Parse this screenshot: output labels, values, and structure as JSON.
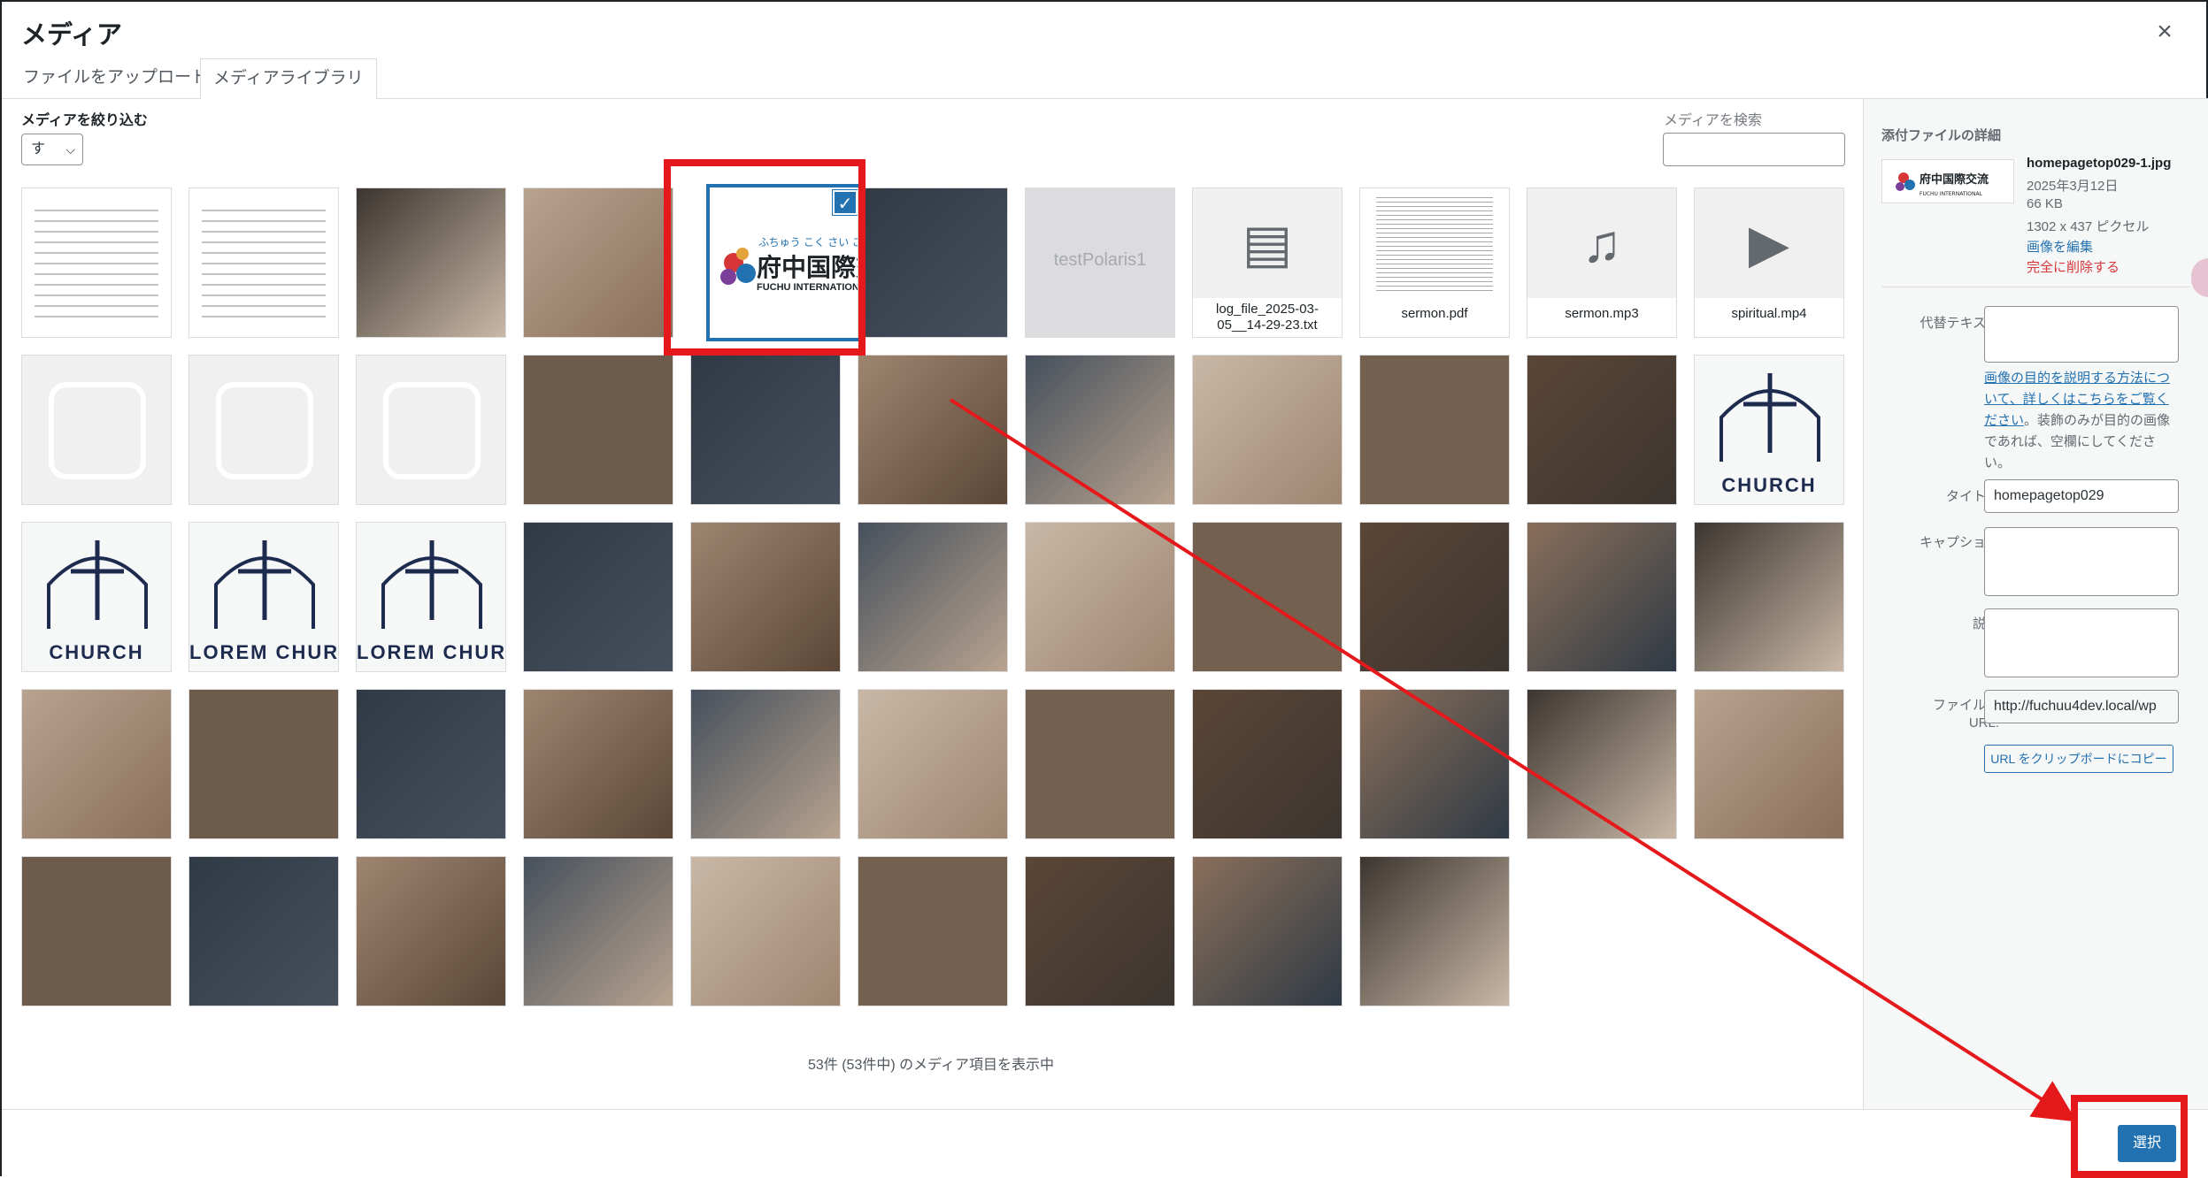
{
  "modal": {
    "title": "メディア",
    "close_glyph": "×",
    "tabs": {
      "upload": "ファイルをアップロード",
      "library": "メディアライブラリ"
    }
  },
  "toolbar": {
    "filter_label": "メディアを絞り込む",
    "filter_value": "す",
    "search_label": "メディアを検索",
    "search_value": ""
  },
  "media": [
    {
      "row": 0,
      "col": 0,
      "kind": "image",
      "desc": "japanese-worksheet"
    },
    {
      "row": 0,
      "col": 1,
      "kind": "image",
      "desc": "document-table"
    },
    {
      "row": 0,
      "col": 2,
      "kind": "image",
      "desc": "classroom-study"
    },
    {
      "row": 0,
      "col": 3,
      "kind": "image",
      "desc": "group-photo"
    },
    {
      "row": 0,
      "col": 4,
      "kind": "image",
      "desc": "fuchu-logo",
      "selected": true,
      "logo_text": "府中国際交",
      "logo_sub": "FUCHU INTERNATIONA",
      "logo_kana": "ふちゅう こく さい こう"
    },
    {
      "row": 0,
      "col": 5,
      "kind": "image",
      "desc": "group-photo-2"
    },
    {
      "row": 0,
      "col": 6,
      "kind": "placeholder",
      "text": "testPolaris1"
    },
    {
      "row": 0,
      "col": 7,
      "kind": "file",
      "glyph": "▤",
      "caption": "log_file_2025-03-05__14-29-23.txt"
    },
    {
      "row": 0,
      "col": 8,
      "kind": "pdf",
      "caption": "sermon.pdf"
    },
    {
      "row": 0,
      "col": 9,
      "kind": "file",
      "glyph": "♫",
      "caption": "sermon.mp3"
    },
    {
      "row": 0,
      "col": 10,
      "kind": "file",
      "glyph": "▶",
      "caption": "spiritual.mp4"
    },
    {
      "row": 1,
      "col": 0,
      "kind": "image",
      "desc": "heart-handshake-icon"
    },
    {
      "row": 1,
      "col": 1,
      "kind": "image",
      "desc": "church-outline"
    },
    {
      "row": 1,
      "col": 2,
      "kind": "image",
      "desc": "praying-hands-icon"
    },
    {
      "row": 1,
      "col": 3,
      "kind": "image",
      "desc": "priest-1"
    },
    {
      "row": 1,
      "col": 4,
      "kind": "image",
      "desc": "pastor-stole"
    },
    {
      "row": 1,
      "col": 5,
      "kind": "image",
      "desc": "priest-bible"
    },
    {
      "row": 1,
      "col": 6,
      "kind": "image",
      "desc": "priest-seated"
    },
    {
      "row": 1,
      "col": 7,
      "kind": "image",
      "desc": "man-arms-crossed"
    },
    {
      "row": 1,
      "col": 8,
      "kind": "image",
      "desc": "man-blazer"
    },
    {
      "row": 1,
      "col": 9,
      "kind": "image",
      "desc": "woman-smiling"
    },
    {
      "row": 1,
      "col": 10,
      "kind": "logo",
      "desc": "church-cross-doves",
      "text": "CHURCH"
    },
    {
      "row": 2,
      "col": 0,
      "kind": "logo",
      "desc": "church-hands-star",
      "text": "CHURCH"
    },
    {
      "row": 2,
      "col": 1,
      "kind": "logo",
      "desc": "lorem-church-arch",
      "text": "LOREM CHURCH"
    },
    {
      "row": 2,
      "col": 2,
      "kind": "logo",
      "desc": "lorem-church-building",
      "text": "LOREM CHURC"
    },
    {
      "row": 2,
      "col": 3,
      "kind": "image",
      "desc": "man-thinking"
    },
    {
      "row": 2,
      "col": 4,
      "kind": "image",
      "desc": "woman-reading"
    },
    {
      "row": 2,
      "col": 5,
      "kind": "image",
      "desc": "woman-lake"
    },
    {
      "row": 2,
      "col": 6,
      "kind": "image",
      "desc": "hands-jesus"
    },
    {
      "row": 2,
      "col": 7,
      "kind": "image",
      "desc": "family-prayer"
    },
    {
      "row": 2,
      "col": 8,
      "kind": "image",
      "desc": "couple-praying"
    },
    {
      "row": 2,
      "col": 9,
      "kind": "image",
      "desc": "pastor-purple"
    },
    {
      "row": 2,
      "col": 10,
      "kind": "image",
      "desc": "woman-pink"
    },
    {
      "row": 3,
      "col": 0,
      "kind": "image",
      "desc": "praying-rosary-dark"
    },
    {
      "row": 3,
      "col": 1,
      "kind": "image",
      "desc": "baptism"
    },
    {
      "row": 3,
      "col": 2,
      "kind": "image",
      "desc": "sunset-bible"
    },
    {
      "row": 3,
      "col": 3,
      "kind": "image",
      "desc": "woman-praying-blur"
    },
    {
      "row": 3,
      "col": 4,
      "kind": "image",
      "desc": "raised-hands-bw"
    },
    {
      "row": 3,
      "col": 5,
      "kind": "image",
      "desc": "teacher-whiteboard"
    },
    {
      "row": 3,
      "col": 6,
      "kind": "image",
      "desc": "cross-sunlight"
    },
    {
      "row": 3,
      "col": 7,
      "kind": "image",
      "desc": "crucifix-gold"
    },
    {
      "row": 3,
      "col": 8,
      "kind": "image",
      "desc": "church-interior"
    },
    {
      "row": 3,
      "col": 9,
      "kind": "image",
      "desc": "candles"
    },
    {
      "row": 3,
      "col": 10,
      "kind": "image",
      "desc": "pastor-pews"
    },
    {
      "row": 4,
      "col": 0,
      "kind": "image",
      "desc": "altar-bible"
    },
    {
      "row": 4,
      "col": 1,
      "kind": "image",
      "desc": "man-aisle"
    },
    {
      "row": 4,
      "col": 2,
      "kind": "image",
      "desc": "man-kneeling"
    },
    {
      "row": 4,
      "col": 3,
      "kind": "image",
      "desc": "rosary-hands"
    },
    {
      "row": 4,
      "col": 4,
      "kind": "image",
      "desc": "women-group"
    },
    {
      "row": 4,
      "col": 5,
      "kind": "image",
      "desc": "woman-field"
    },
    {
      "row": 4,
      "col": 6,
      "kind": "image",
      "desc": "bible-table"
    },
    {
      "row": 4,
      "col": 7,
      "kind": "image",
      "desc": "guitar"
    },
    {
      "row": 4,
      "col": 8,
      "kind": "image",
      "desc": "cathedral"
    }
  ],
  "count_text": "53件 (53件中) のメディア項目を表示中",
  "details": {
    "title": "添付ファイルの詳細",
    "filename": "homepagetop029-1.jpg",
    "date": "2025年3月12日",
    "size": "66 KB",
    "dimensions": "1302 x 437 ピクセル",
    "edit_link": "画像を編集",
    "delete_link": "完全に削除する",
    "alt_label": "代替テキスト",
    "alt_value": "",
    "help_link": "画像の目的を説明する方法について、詳しくはこちらをご覧ください",
    "help_rest": "。装飾のみが目的の画像であれば、空欄にしてください。",
    "title_label": "タイトル",
    "title_value": "homepagetop029",
    "caption_label": "キャプション",
    "caption_value": "",
    "desc_label": "説明",
    "desc_value": "",
    "url_label": "ファイルの URL:",
    "url_value": "http://fuchuu4dev.local/wp",
    "copy_button": "URL をクリップボードにコピー"
  },
  "footer": {
    "select_button": "選択"
  },
  "colors": {
    "accent": "#2271b1",
    "annotation": "#e5191b",
    "danger": "#d63638"
  }
}
